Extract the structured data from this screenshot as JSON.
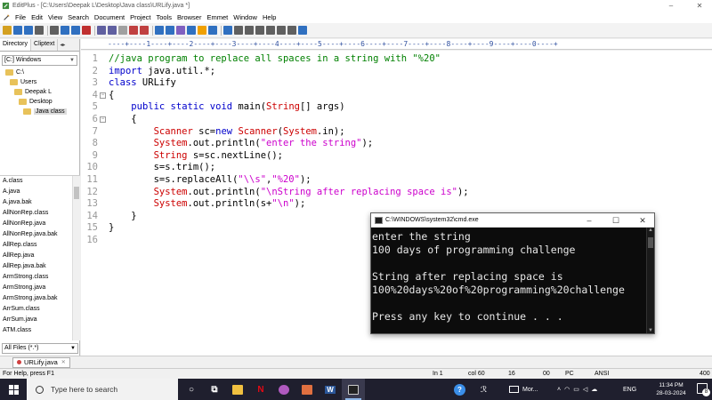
{
  "window": {
    "title": "EditPlus - [C:\\Users\\Deepak L\\Desktop\\Java class\\URLify.java *]",
    "controls": [
      "–",
      "❐",
      "✕"
    ]
  },
  "menu": [
    "File",
    "Edit",
    "View",
    "Search",
    "Document",
    "Project",
    "Tools",
    "Browser",
    "Emmet",
    "Window",
    "Help"
  ],
  "toolbar": {
    "colors": [
      "#d4a020",
      "#3070c0",
      "#3070c0",
      "#606060",
      "#606060",
      "#3070c0",
      "#3070c0",
      "#c03030",
      "#6060a0",
      "#6060a0",
      "#a0a0a0",
      "#c04040",
      "#c04040",
      "#3070c0",
      "#3070c0",
      "#8060c0",
      "#3070c0",
      "#f0a000",
      "#3070c0",
      "#3070c0",
      "#606060",
      "#606060",
      "#606060",
      "#606060",
      "#606060",
      "#606060",
      "#3070c0"
    ]
  },
  "sidebar": {
    "tabs": [
      "Directory",
      "Cliptext"
    ],
    "arrows": "◂▸",
    "drive": "[C:] Windows",
    "tree": [
      {
        "label": "C:\\",
        "indent": 0
      },
      {
        "label": "Users",
        "indent": 1
      },
      {
        "label": "Deepak L",
        "indent": 2
      },
      {
        "label": "Desktop",
        "indent": 3
      },
      {
        "label": "Java class",
        "indent": 4,
        "selected": true
      }
    ],
    "files": [
      "A.class",
      "A.java",
      "A.java.bak",
      "AllNonRep.class",
      "AllNonRep.java",
      "AllNonRep.java.bak",
      "AllRep.class",
      "AllRep.java",
      "AllRep.java.bak",
      "ArmStrong.class",
      "ArmStrong.java",
      "ArmStrong.java.bak",
      "ArrSum.class",
      "ArrSum.java",
      "ATM.class"
    ],
    "filter": "All Files (*.*)"
  },
  "ruler": "----+----1----+----2----+----3----+----4----+----5----+----6----+----7----+----8----+----9----+----0----+",
  "editor": {
    "lines": [
      {
        "n": "1",
        "fold": "",
        "tokens": [
          [
            "c-comment",
            "//java program to replace all spaces in a string with \"%20\""
          ]
        ]
      },
      {
        "n": "2",
        "fold": "",
        "tokens": [
          [
            "c-kw",
            "import"
          ],
          [
            "c-plain",
            " java.util.*;"
          ]
        ]
      },
      {
        "n": "3",
        "fold": "",
        "tokens": [
          [
            "c-kw",
            "class"
          ],
          [
            "c-plain",
            " URLify"
          ]
        ]
      },
      {
        "n": "4",
        "fold": "⊟",
        "tokens": [
          [
            "c-plain",
            "{"
          ]
        ]
      },
      {
        "n": "5",
        "fold": "",
        "tokens": [
          [
            "c-plain",
            "    "
          ],
          [
            "c-kw",
            "public static void"
          ],
          [
            "c-plain",
            " main("
          ],
          [
            "c-type",
            "String"
          ],
          [
            "c-plain",
            "[] args)"
          ]
        ]
      },
      {
        "n": "6",
        "fold": "⊟",
        "tokens": [
          [
            "c-plain",
            "    {"
          ]
        ]
      },
      {
        "n": "7",
        "fold": "",
        "tokens": [
          [
            "c-plain",
            "        "
          ],
          [
            "c-type",
            "Scanner"
          ],
          [
            "c-plain",
            " sc="
          ],
          [
            "c-kw",
            "new"
          ],
          [
            "c-plain",
            " "
          ],
          [
            "c-type",
            "Scanner"
          ],
          [
            "c-plain",
            "("
          ],
          [
            "c-type",
            "System"
          ],
          [
            "c-plain",
            ".in);"
          ]
        ]
      },
      {
        "n": "8",
        "fold": "",
        "tokens": [
          [
            "c-plain",
            "        "
          ],
          [
            "c-type",
            "System"
          ],
          [
            "c-plain",
            ".out.println("
          ],
          [
            "c-str",
            "\"enter the string\""
          ],
          [
            "c-plain",
            ");"
          ]
        ]
      },
      {
        "n": "9",
        "fold": "",
        "tokens": [
          [
            "c-plain",
            "        "
          ],
          [
            "c-type",
            "String"
          ],
          [
            "c-plain",
            " s=sc.nextLine();"
          ]
        ]
      },
      {
        "n": "10",
        "fold": "",
        "tokens": [
          [
            "c-plain",
            "        s=s.trim();"
          ]
        ]
      },
      {
        "n": "11",
        "fold": "",
        "tokens": [
          [
            "c-plain",
            "        s=s.replaceAll("
          ],
          [
            "c-str",
            "\"\\\\s\""
          ],
          [
            "c-plain",
            ","
          ],
          [
            "c-str",
            "\"%20\""
          ],
          [
            "c-plain",
            ");"
          ]
        ]
      },
      {
        "n": "12",
        "fold": "",
        "tokens": [
          [
            "c-plain",
            "        "
          ],
          [
            "c-type",
            "System"
          ],
          [
            "c-plain",
            ".out.println("
          ],
          [
            "c-str",
            "\"\\nString after replacing space is\""
          ],
          [
            "c-plain",
            ");"
          ]
        ]
      },
      {
        "n": "13",
        "fold": "",
        "tokens": [
          [
            "c-plain",
            "        "
          ],
          [
            "c-type",
            "System"
          ],
          [
            "c-plain",
            ".out.println(s+"
          ],
          [
            "c-str",
            "\"\\n\""
          ],
          [
            "c-plain",
            ");"
          ]
        ]
      },
      {
        "n": "14",
        "fold": "",
        "tokens": [
          [
            "c-plain",
            "    }"
          ]
        ]
      },
      {
        "n": "15",
        "fold": "",
        "tokens": [
          [
            "c-plain",
            "}"
          ]
        ]
      },
      {
        "n": "16",
        "fold": "",
        "tokens": []
      }
    ]
  },
  "doc_tab": "URLify.java",
  "status": {
    "help": "For Help, press F1",
    "ln": "In 1",
    "col": "col 60",
    "n16": "16",
    "mode": "00",
    "pc": "PC",
    "enc": "ANSI",
    "n400": "400"
  },
  "console": {
    "title": "C:\\WINDOWS\\system32\\cmd.exe",
    "controls": [
      "–",
      "☐",
      "✕"
    ],
    "lines": [
      "enter the string",
      "100 days of programming challenge",
      "",
      "String after replacing space is",
      "100%20days%20of%20programming%20challenge",
      "",
      "Press any key to continue . . ."
    ]
  },
  "taskbar": {
    "search_placeholder": "Type here to search",
    "apps": [
      {
        "name": "cortana-icon",
        "color": "#ffffff",
        "glyph": "○"
      },
      {
        "name": "task-view-icon",
        "color": "#ffffff",
        "glyph": "⧉"
      },
      {
        "name": "file-explorer-icon",
        "color": "#f0c040",
        "glyph": ""
      },
      {
        "name": "netflix-icon",
        "color": "#e50914",
        "glyph": "N"
      },
      {
        "name": "browser-icon",
        "color": "#b05ac0",
        "glyph": ""
      },
      {
        "name": "paint-icon",
        "color": "#e07040",
        "glyph": ""
      },
      {
        "name": "word-icon",
        "color": "#2b579a",
        "glyph": "W"
      },
      {
        "name": "cmd-icon",
        "color": "#222222",
        "glyph": ""
      }
    ],
    "tray": {
      "help": "?",
      "people": "ℛ",
      "news": "Mor...",
      "lang": "ENG",
      "time": "11:34 PM",
      "date": "28-03-2024",
      "notif_count": "8"
    }
  }
}
